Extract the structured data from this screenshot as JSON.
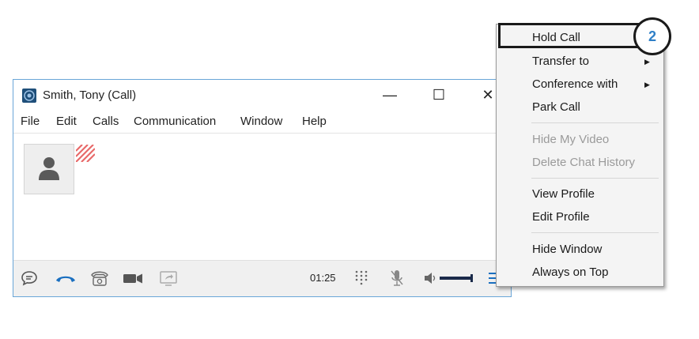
{
  "window": {
    "title": "Smith, Tony (Call)",
    "controls": {
      "minimize": "—",
      "maximize": "☐",
      "close": "✕"
    },
    "menu": [
      "File",
      "Edit",
      "Calls",
      "Communication",
      "Window",
      "Help"
    ],
    "avatar_icon": "user-silhouette-icon",
    "status_color": "#e86a6a"
  },
  "toolbar": {
    "timer": "01:25",
    "icons": [
      "chat-icon",
      "hang-up-icon",
      "desk-phone-icon",
      "video-icon",
      "screen-share-icon",
      "dialpad-icon",
      "mic-muted-icon",
      "volume-icon",
      "menu-icon"
    ],
    "accent": "#1a6fc0"
  },
  "context_menu": {
    "items": [
      {
        "label": "Hold Call",
        "enabled": true
      },
      {
        "label": "Transfer to",
        "enabled": true,
        "submenu": true
      },
      {
        "label": "Conference with",
        "enabled": true,
        "submenu": true
      },
      {
        "label": "Park Call",
        "enabled": true
      },
      {
        "label": "Hide My Video",
        "enabled": false
      },
      {
        "label": "Delete Chat History",
        "enabled": false
      },
      {
        "label": "View Profile",
        "enabled": true
      },
      {
        "label": "Edit Profile",
        "enabled": true
      },
      {
        "label": "Hide Window",
        "enabled": true
      },
      {
        "label": "Always on Top",
        "enabled": true
      }
    ],
    "submenu_arrow": "▶"
  },
  "callout": {
    "number": "2",
    "color": "#2e7fc7"
  }
}
